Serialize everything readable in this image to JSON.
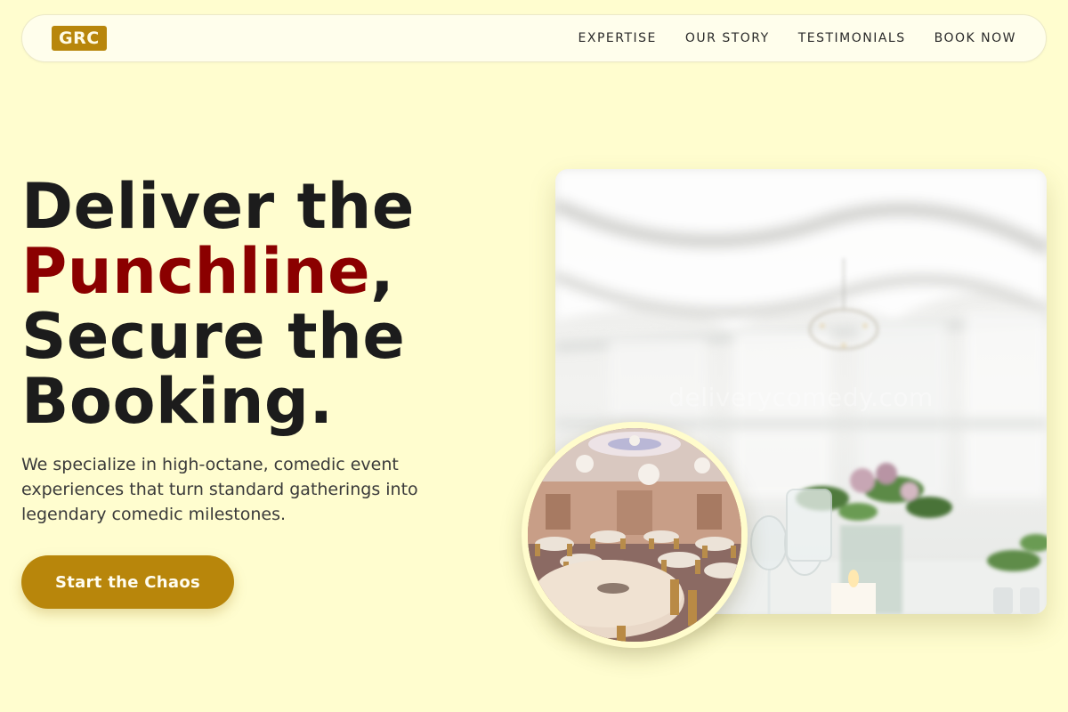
{
  "nav": {
    "logo": "GRC",
    "links": [
      "EXPERTISE",
      "OUR STORY",
      "TESTIMONIALS",
      "BOOK NOW"
    ]
  },
  "hero": {
    "title_line1": "Deliver the",
    "title_accent": "Punchline",
    "title_comma": ",",
    "title_line3": "Secure the",
    "title_line4": "Booking.",
    "subtitle": "We specialize in high-octane, comedic event experiences that turn standard gatherings into legendary comedic milestones.",
    "cta_label": "Start the Chaos"
  },
  "images": {
    "main_watermark": "deliverycomedy.com"
  },
  "colors": {
    "background": "#fffdcf",
    "accent_gold": "#b8860b",
    "accent_red": "#8b0000"
  }
}
